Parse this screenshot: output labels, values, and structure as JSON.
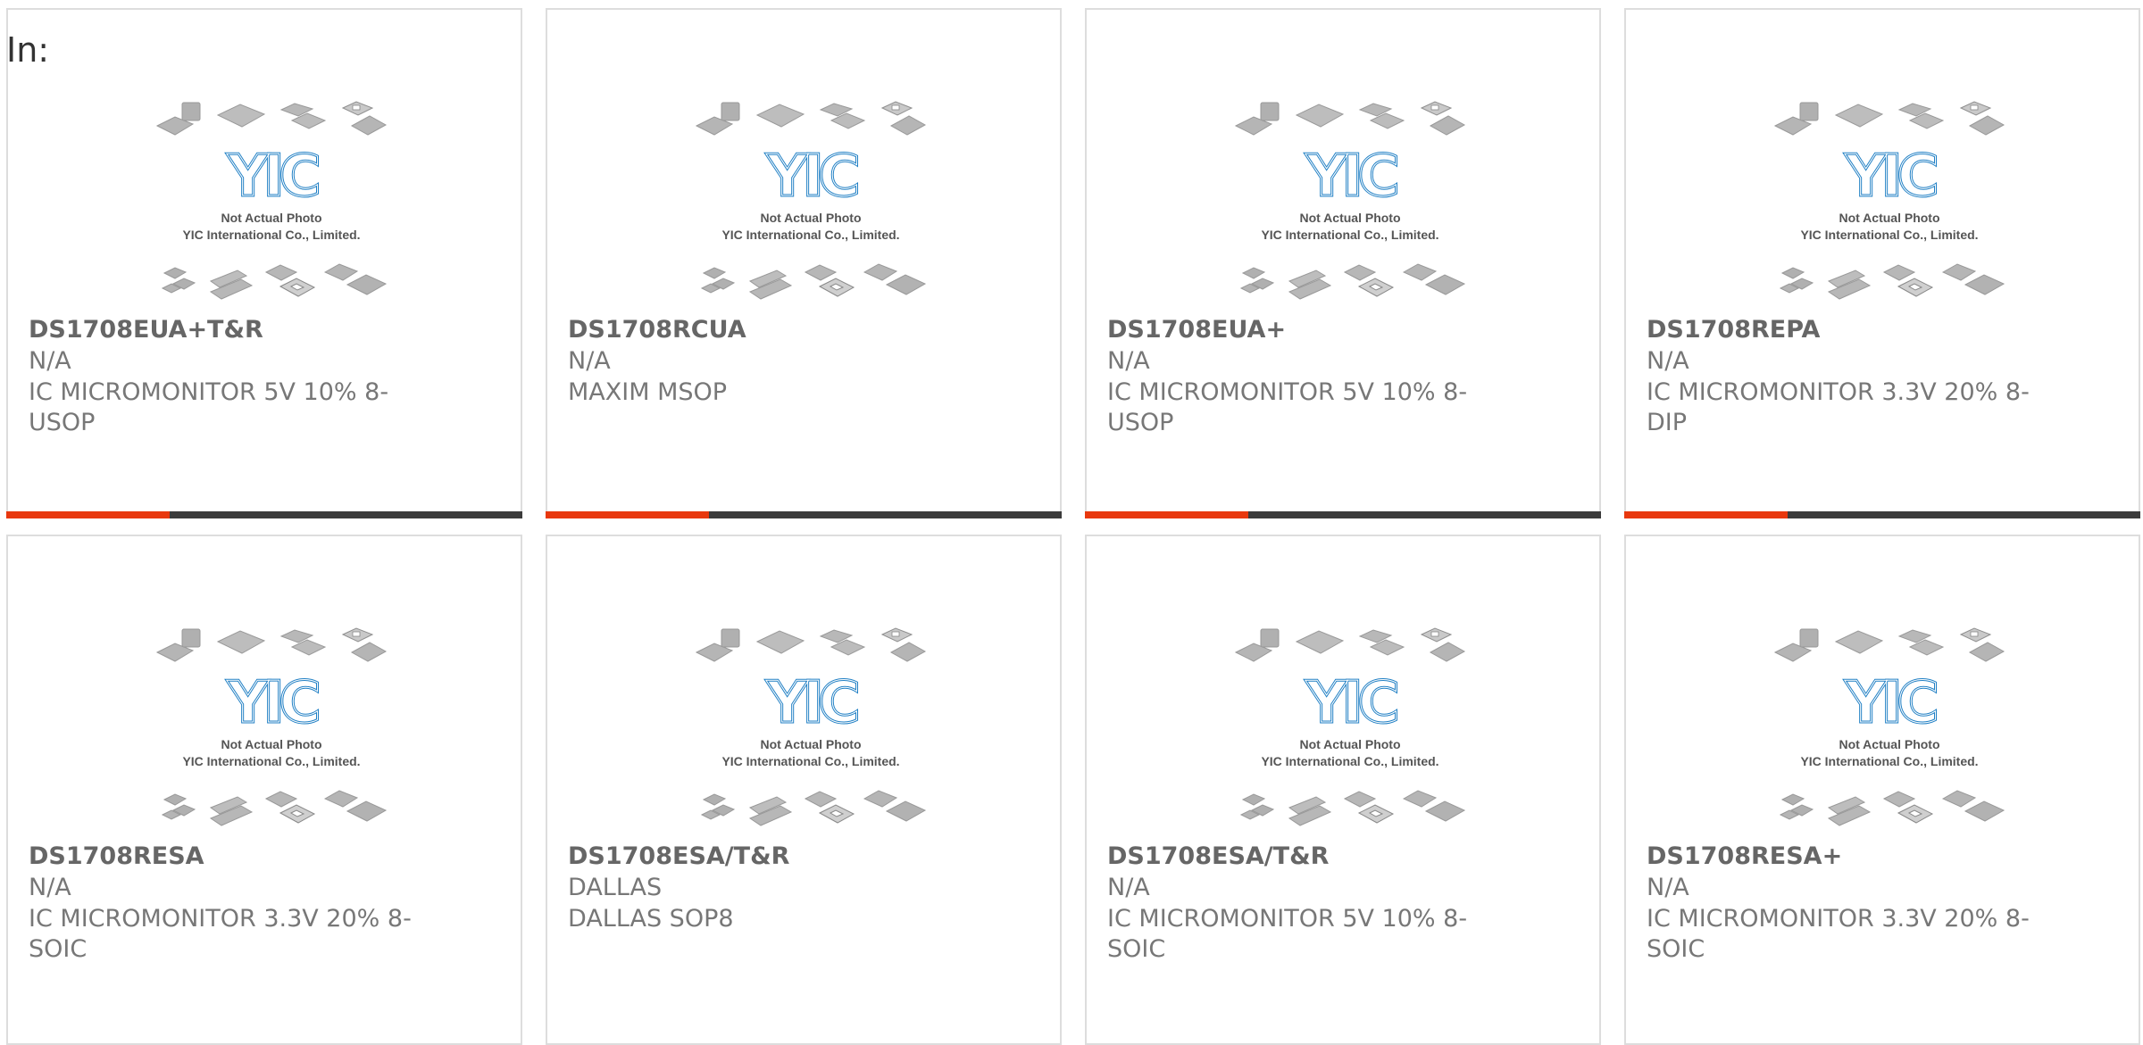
{
  "page": {
    "in_label": "In:"
  },
  "photo": {
    "logo": "YIC",
    "line1": "Not Actual Photo",
    "line2": "YIC International Co., Limited."
  },
  "colors": {
    "accent": "#e8380e",
    "bar_dark": "#3b3b3b",
    "logo_blue": "#1f7fc4"
  },
  "products": [
    {
      "name": "DS1708EUA+T&R",
      "brand": "N/A",
      "desc": "IC MICROMONITOR 5V 10% 8-USOP"
    },
    {
      "name": "DS1708RCUA",
      "brand": "N/A",
      "desc": "MAXIM MSOP"
    },
    {
      "name": "DS1708EUA+",
      "brand": "N/A",
      "desc": "IC MICROMONITOR 5V 10% 8-USOP"
    },
    {
      "name": "DS1708REPA",
      "brand": "N/A",
      "desc": "IC MICROMONITOR 3.3V 20% 8-DIP"
    },
    {
      "name": "DS1708RESA",
      "brand": "N/A",
      "desc": "IC MICROMONITOR 3.3V 20% 8-SOIC"
    },
    {
      "name": "DS1708ESA/T&R",
      "brand": "DALLAS",
      "desc": "DALLAS SOP8"
    },
    {
      "name": "DS1708ESA/T&R",
      "brand": "N/A",
      "desc": "IC MICROMONITOR 5V 10% 8-SOIC"
    },
    {
      "name": "DS1708RESA+",
      "brand": "N/A",
      "desc": "IC MICROMONITOR 3.3V 20% 8-SOIC"
    }
  ]
}
